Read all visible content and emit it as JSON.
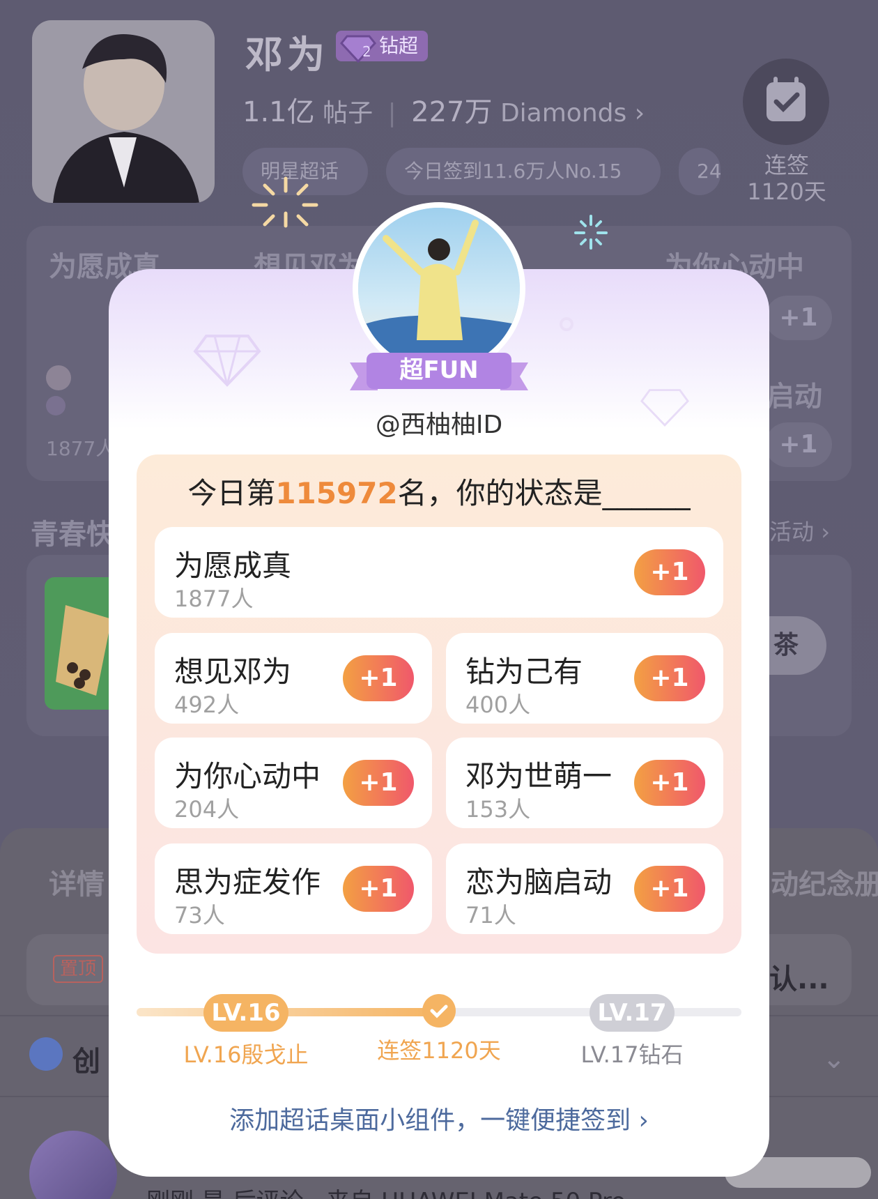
{
  "star": {
    "name": "邓为",
    "badge": "钻超",
    "badge_level": "2",
    "posts_value": "1.1亿",
    "posts_label": "帖子",
    "diamonds_value": "227万",
    "diamonds_label": "Diamonds",
    "chips": [
      "明星超话",
      "今日签到11.6万人No.15",
      "24"
    ],
    "checkin_label": "连签",
    "checkin_days": "1120天"
  },
  "background": {
    "cards": [
      {
        "label": "为愿成真",
        "count": "1877人"
      },
      {
        "label": "想见邓为"
      },
      {
        "label": "钻为己有"
      },
      {
        "label": "为你心动中"
      },
      {
        "label": "启动"
      }
    ],
    "plus": "+1",
    "section_title": "青春快",
    "section_more": "活动",
    "tea_button": "茶",
    "sheet": {
      "tab_left": "详情",
      "tab_right": "动纪念册",
      "pinned_tag": "置顶",
      "pinned_text": "认...",
      "row_text": "创",
      "post_text": "刚刚 是 后评论 · 来自 HUAWEI Mate 50 Pro"
    }
  },
  "modal": {
    "badge": "超FUN",
    "username": "@西柚柚ID",
    "question_prefix": "今日第",
    "rank": "115972",
    "question_suffix": "名，你的状态是______",
    "plus_label": "+1",
    "options": [
      {
        "name": "为愿成真",
        "count": "1877人"
      },
      {
        "name": "想见邓为",
        "count": "492人"
      },
      {
        "name": "钻为己有",
        "count": "400人"
      },
      {
        "name": "为你心动中",
        "count": "204人"
      },
      {
        "name": "邓为世萌一",
        "count": "153人"
      },
      {
        "name": "思为症发作",
        "count": "73人"
      },
      {
        "name": "恋为脑启动",
        "count": "71人"
      }
    ],
    "level": {
      "current_pill": "LV.16",
      "current_label": "LV.16殷戈止",
      "progress_label": "连签1120天",
      "next_pill": "LV.17",
      "next_label": "LV.17钻石",
      "progress_fraction": 0.5
    },
    "widget_link": "添加超话桌面小组件，一键便捷签到"
  },
  "colors": {
    "accent_orange": "#ee8a3b",
    "button_gradient_start": "#f3a043",
    "button_gradient_end": "#f0586b",
    "level_current": "#f5b463",
    "level_next": "#cfcfd6",
    "link_blue": "#4d6a9d",
    "badge_purple": "#8e6bb1"
  }
}
